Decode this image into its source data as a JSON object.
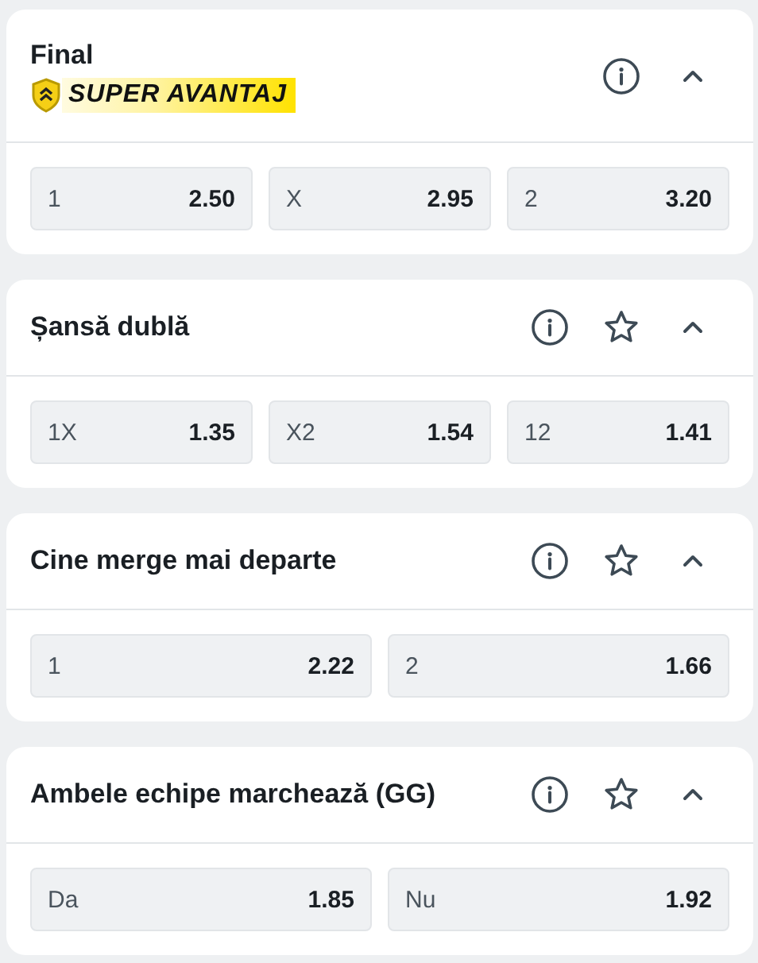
{
  "markets": [
    {
      "title": "Final",
      "badge": "SUPER AVANTAJ",
      "expanded": true,
      "odds": [
        {
          "label": "1",
          "value": "2.50"
        },
        {
          "label": "X",
          "value": "2.95"
        },
        {
          "label": "2",
          "value": "3.20"
        }
      ]
    },
    {
      "title": "Șansă dublă",
      "favorite": false,
      "expanded": true,
      "odds": [
        {
          "label": "1X",
          "value": "1.35"
        },
        {
          "label": "X2",
          "value": "1.54"
        },
        {
          "label": "12",
          "value": "1.41"
        }
      ]
    },
    {
      "title": "Cine merge mai departe",
      "favorite": false,
      "expanded": true,
      "odds": [
        {
          "label": "1",
          "value": "2.22"
        },
        {
          "label": "2",
          "value": "1.66"
        }
      ]
    },
    {
      "title": "Ambele echipe marchează (GG)",
      "favorite": false,
      "expanded": true,
      "odds": [
        {
          "label": "Da",
          "value": "1.85"
        },
        {
          "label": "Nu",
          "value": "1.92"
        }
      ]
    }
  ]
}
